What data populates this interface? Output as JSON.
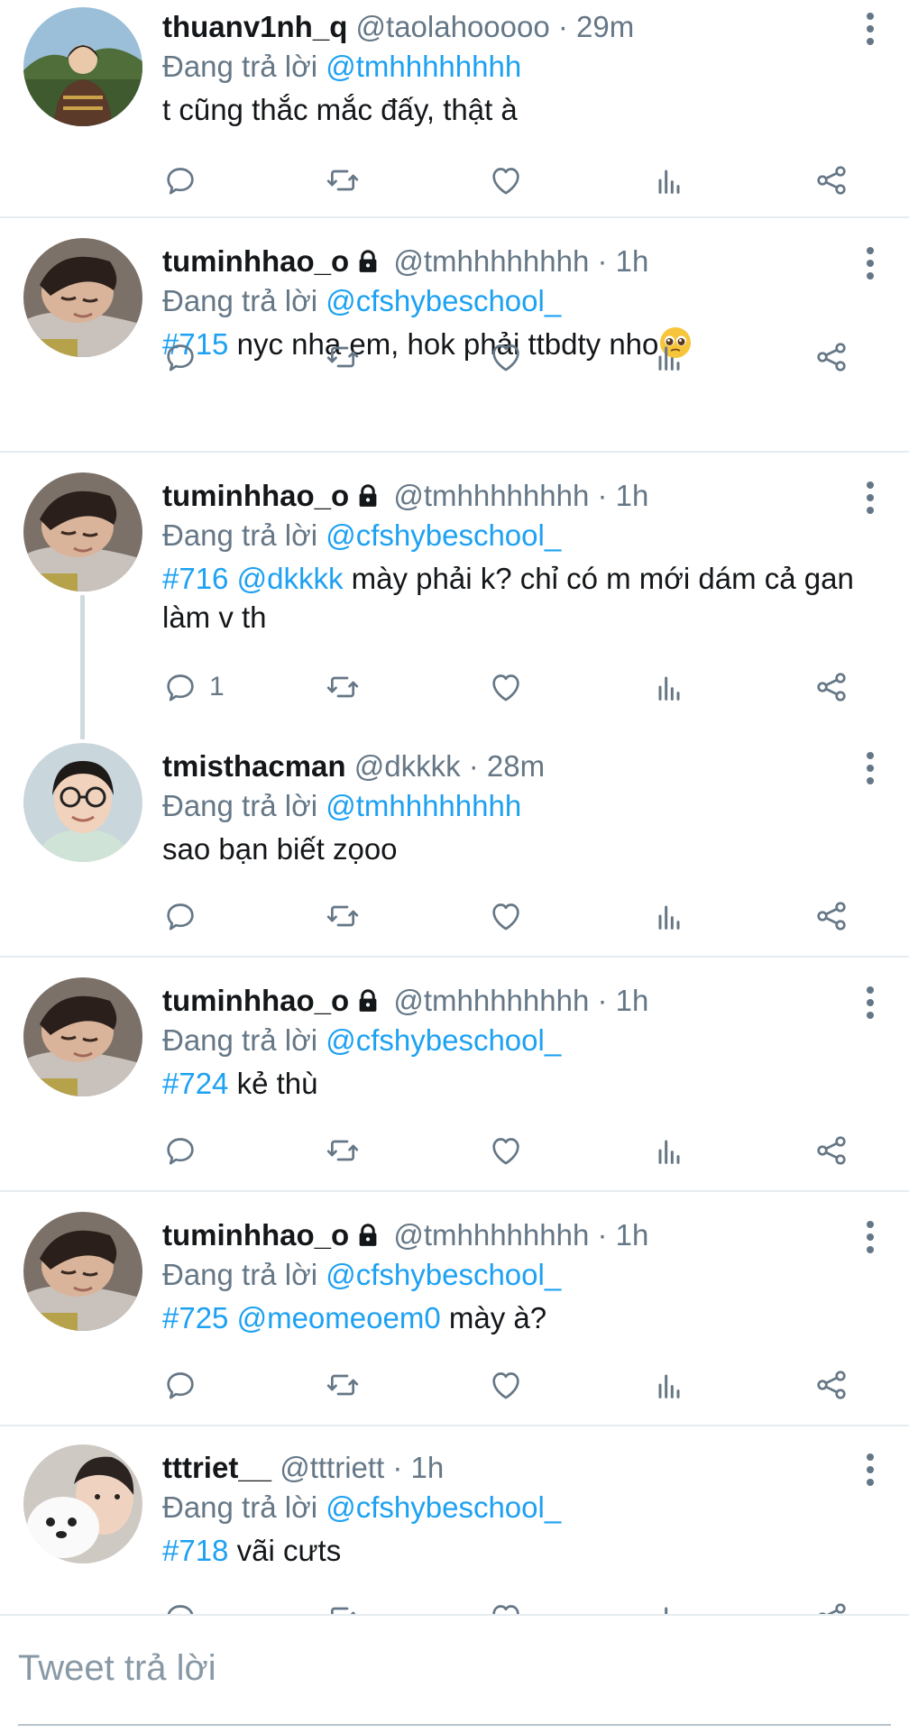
{
  "icons": {
    "reply": "reply-icon",
    "retweet": "retweet-icon",
    "like": "heart-icon",
    "analytics": "analytics-icon",
    "share": "share-icon",
    "more": "more-vertical-icon",
    "lock": "lock-icon"
  },
  "colors": {
    "link": "#1da1f2",
    "muted": "#657786",
    "divider": "#e6ecf0"
  },
  "tweets": [
    {
      "name": "thuanv1nh_q",
      "handle": "@taolahooooo",
      "dot": " · ",
      "time": "29m",
      "reply_label": "Đang trả lời ",
      "reply_to": "@tmhhhhhhhh",
      "text": "t cũng thắc mắc đấy, thật à",
      "reply_count": ""
    },
    {
      "name": "tuminhhao_o",
      "handle": "@tmhhhhhhhh",
      "dot": " · ",
      "time": "1h",
      "reply_label": "Đang trả lời ",
      "reply_to": "@cfshybeschool_",
      "tag": "#715",
      "text": " nyc nha em, hok phải ttbdty nho",
      "emoji": "pleading-face-emoji",
      "reply_count": ""
    },
    {
      "name": "tuminhhao_o",
      "handle": "@tmhhhhhhhh",
      "dot": " · ",
      "time": "1h",
      "reply_label": "Đang trả lời ",
      "reply_to": "@cfshybeschool_",
      "tag": "#716",
      "mention": " @dkkkk",
      "text": " mày phải k? chỉ có m mới dám cả gan làm v th",
      "reply_count": "1"
    },
    {
      "name": "tmisthacman",
      "handle": "@dkkkk",
      "dot": " · ",
      "time": "28m",
      "reply_label": "Đang trả lời ",
      "reply_to": "@tmhhhhhhhh",
      "text": "sao bạn biết zọoo",
      "reply_count": ""
    },
    {
      "name": "tuminhhao_o",
      "handle": "@tmhhhhhhhh",
      "dot": " · ",
      "time": "1h",
      "reply_label": "Đang trả lời ",
      "reply_to": "@cfshybeschool_",
      "tag": "#724",
      "text": " kẻ thù",
      "reply_count": ""
    },
    {
      "name": "tuminhhao_o",
      "handle": "@tmhhhhhhhh",
      "dot": " · ",
      "time": "1h",
      "reply_label": "Đang trả lời ",
      "reply_to": "@cfshybeschool_",
      "tag": "#725",
      "mention": " @meomeoem0",
      "text": " mày à?",
      "reply_count": ""
    },
    {
      "name": "tttriet__",
      "handle": "@tttriett",
      "dot": " · ",
      "time": "1h",
      "reply_label": "Đang trả lời ",
      "reply_to": "@cfshybeschool_",
      "tag": "#718",
      "text": " vãi cưts",
      "reply_count": ""
    }
  ],
  "reply_bar": {
    "placeholder": "Tweet trả lời"
  }
}
